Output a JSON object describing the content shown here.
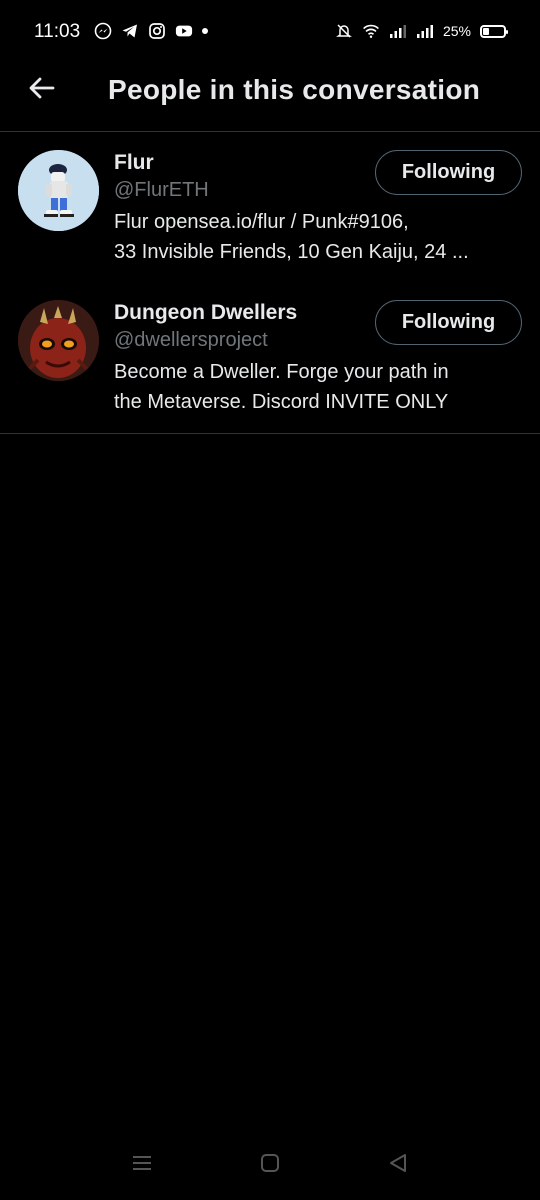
{
  "status_bar": {
    "time": "11:03",
    "left_icons": [
      "messenger-icon",
      "telegram-icon",
      "instagram-icon",
      "youtube-icon",
      "notification-dot"
    ],
    "right_icons": [
      "mute-icon",
      "wifi-icon",
      "signal-1-icon",
      "signal-2-icon"
    ],
    "battery_percent": "25%",
    "battery_level": 0.25
  },
  "header": {
    "back_icon": "arrow-left-icon",
    "title": "People in this conversation"
  },
  "people": [
    {
      "name": "Flur",
      "handle": "@FlurETH",
      "bio_lines": [
        "Flur opensea.io/flur / Punk#9106,",
        "33 Invisible Friends, 10 Gen Kaiju, 24 ..."
      ],
      "follow_label": "Following",
      "avatar_bg": "#c8dff0"
    },
    {
      "name": "Dungeon Dwellers",
      "handle": "@dwellersproject",
      "bio_lines": [
        "Become a Dweller. Forge your path in",
        "the Metaverse. Discord INVITE ONLY"
      ],
      "follow_label": "Following",
      "avatar_bg": "#3a1a14"
    }
  ],
  "nav_bar": {
    "icons": [
      "menu-icon",
      "home-square-icon",
      "back-triangle-icon"
    ]
  },
  "colors": {
    "background": "#000000",
    "text_primary": "#e7e9ea",
    "text_secondary": "#71767b",
    "divider": "#2f3336",
    "button_border": "#536471"
  }
}
